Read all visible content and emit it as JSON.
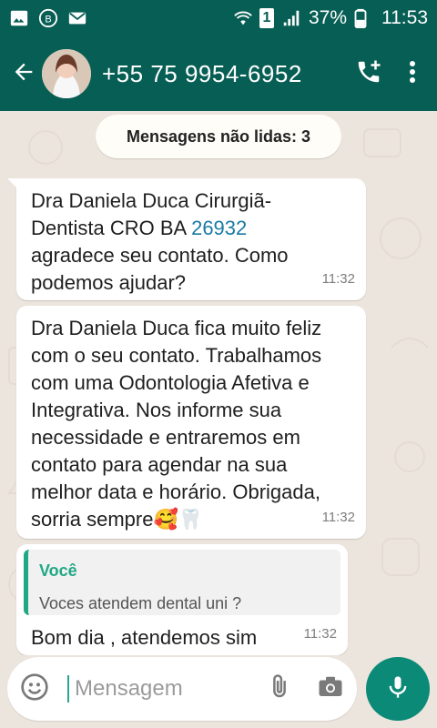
{
  "status_bar": {
    "battery_percent": "37%",
    "time": "11:53",
    "sim_label": "1"
  },
  "appbar": {
    "contact_title": "+55 75 9954-6952"
  },
  "chat": {
    "unread_label": "Mensagens não lidas: 3",
    "messages": [
      {
        "text_line1": "Dra Daniela Duca Cirurgiã-",
        "text_line2_prefix": "Dentista CRO BA ",
        "text_line2_link": "26932",
        "text_line3": "agradece seu contato. Como",
        "text_line4": "podemos ajudar?",
        "time": "11:32"
      },
      {
        "text": "Dra Daniela Duca fica muito feliz com o seu contato. Trabalhamos com uma Odontologia Afetiva e Integrativa. Nos informe sua necessidade e entraremos em contato para agendar na sua melhor data e horário. Obrigada, sorria sempre",
        "emoji": "🥰🦷",
        "time": "11:32"
      },
      {
        "quote_author": "Você",
        "quote_text": "Voces atendem dental uni ?",
        "text": "Bom dia , atendemos sim",
        "time": "11:32"
      }
    ]
  },
  "composer": {
    "placeholder": "Mensagem"
  },
  "icons": {
    "accent": "#075e54",
    "teal": "#20a884"
  }
}
